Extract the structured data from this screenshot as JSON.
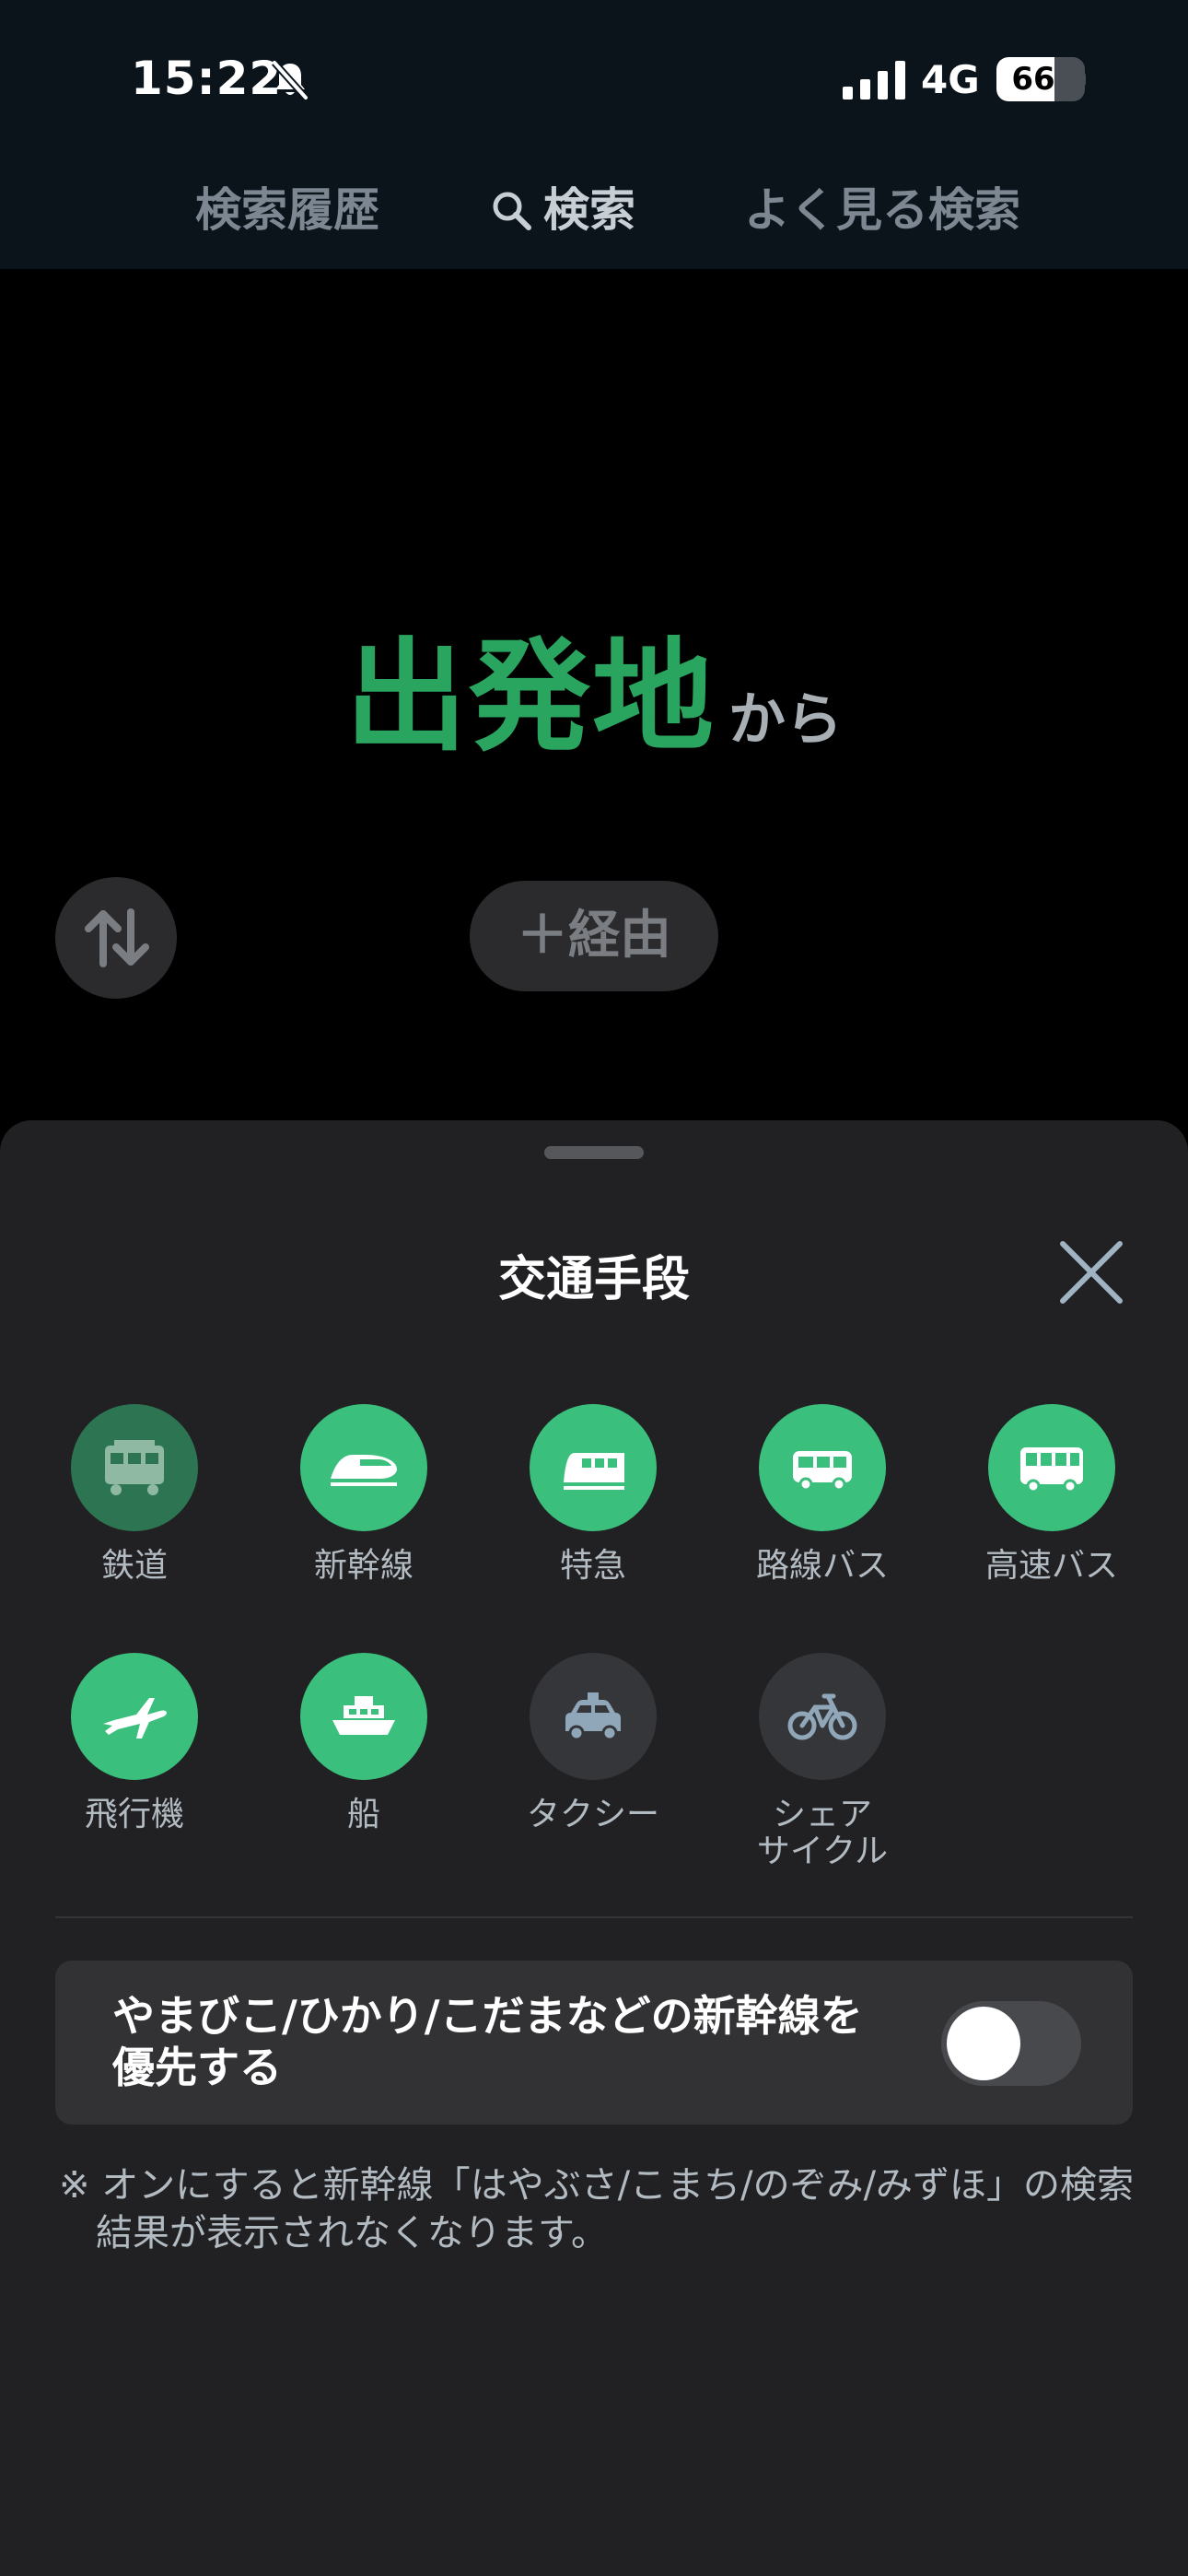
{
  "status_bar": {
    "time": "15:22",
    "network": "4G",
    "battery_level": "66",
    "battery_fraction": 0.66
  },
  "header": {
    "tabs": [
      {
        "label": "検索履歴",
        "active": false
      },
      {
        "label": "検索",
        "active": true,
        "icon": "search-icon"
      },
      {
        "label": "よく見る検索",
        "active": false
      }
    ]
  },
  "main": {
    "origin_placeholder": "出発地",
    "origin_suffix": "から",
    "swap_icon": "swap-vertical-icon",
    "via_button": "＋経由"
  },
  "sheet": {
    "title": "交通手段",
    "close_icon": "close-icon",
    "modes": [
      {
        "label": "鉄道",
        "icon": "train-icon",
        "state": "on-dim"
      },
      {
        "label": "新幹線",
        "icon": "bullet-train-icon",
        "state": "on"
      },
      {
        "label": "特急",
        "icon": "express-train-icon",
        "state": "on"
      },
      {
        "label": "路線バス",
        "icon": "bus-icon",
        "state": "on"
      },
      {
        "label": "高速バス",
        "icon": "highway-bus-icon",
        "state": "on"
      },
      {
        "label": "飛行機",
        "icon": "airplane-icon",
        "state": "on"
      },
      {
        "label": "船",
        "icon": "ship-icon",
        "state": "on"
      },
      {
        "label": "タクシー",
        "icon": "taxi-icon",
        "state": "off"
      },
      {
        "label": "シェア\nサイクル",
        "icon": "bicycle-icon",
        "state": "off"
      }
    ],
    "shinkansen_pref": {
      "label": "やまびこ/ひかり/こだまなどの新幹線を優先する",
      "enabled": false
    },
    "note": "※ オンにすると新幹線「はやぶさ/こまち/のぞみ/みずほ」の検索結果が表示されなくなります。"
  },
  "colors": {
    "accent_green": "#3bbf7c",
    "origin_green": "#2aa560",
    "header_bg": "#0b131b",
    "sheet_bg": "#212124"
  }
}
